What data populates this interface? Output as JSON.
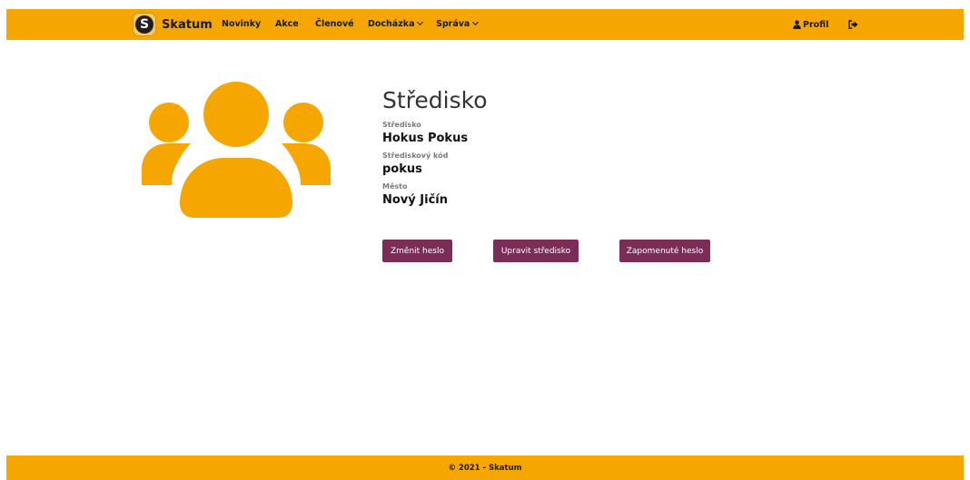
{
  "navbar": {
    "brand": {
      "logo_letter": "S",
      "name": "Skatum"
    },
    "links": [
      {
        "label": "Novinky"
      },
      {
        "label": "Akce"
      },
      {
        "label": "Členové"
      },
      {
        "label": "Docházka"
      },
      {
        "label": "Správa"
      }
    ],
    "profile_label": "Profil"
  },
  "icons": {
    "group": "users-group-icon",
    "profile": "user-icon",
    "logout": "sign-out-icon",
    "dropdown": "chevron-down-icon"
  },
  "colors": {
    "accent": "#f5a600",
    "button": "#7b2d58"
  },
  "main": {
    "title": "Středisko",
    "fields": [
      {
        "label": "Středisko",
        "value": "Hokus Pokus"
      },
      {
        "label": "Střediskový kód",
        "value": "pokus"
      },
      {
        "label": "Město",
        "value": "Nový Jičín"
      }
    ],
    "buttons": [
      {
        "label": "Změnit heslo"
      },
      {
        "label": "Upravit středisko"
      },
      {
        "label": "Zapomenuté heslo"
      }
    ]
  },
  "footer": {
    "text": "© 2021 - Skatum"
  }
}
